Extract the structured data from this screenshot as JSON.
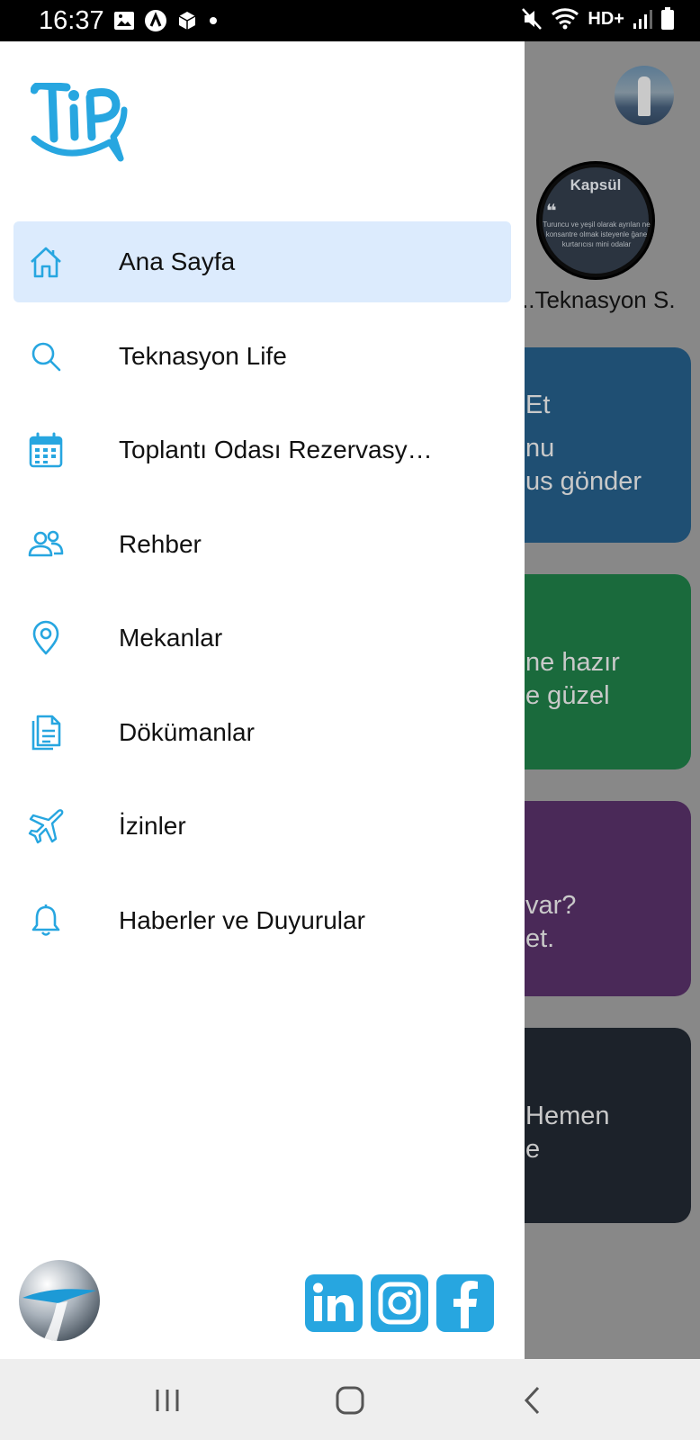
{
  "status_bar": {
    "time": "16:37",
    "network_label": "HD+",
    "icons_left": [
      "image-icon",
      "a-circle-icon",
      "package-icon",
      "dot-icon"
    ],
    "icons_right": [
      "mute-icon",
      "wifi-icon",
      "signal-icon",
      "battery-icon"
    ]
  },
  "background": {
    "story": {
      "title": "Kapsül",
      "quote_mark": "❝",
      "text": "Turuncu ve yeşil olarak ayrılan ne konsantre olmak isteyenle ğane kurtarıcısı mini odalar",
      "label": "..Teknasyon S."
    },
    "cards": [
      {
        "lines": [
          "Et",
          "nu",
          "us gönder"
        ]
      },
      {
        "lines": [
          "ne hazır",
          "e güzel"
        ]
      },
      {
        "lines": [
          "var?",
          "et."
        ]
      },
      {
        "lines": [
          "Hemen",
          "e"
        ]
      }
    ]
  },
  "drawer": {
    "logo_text": "TiP",
    "menu": [
      {
        "label": "Ana Sayfa",
        "icon": "home-icon",
        "active": true
      },
      {
        "label": "Teknasyon Life",
        "icon": "search-icon",
        "active": false
      },
      {
        "label": "Toplantı Odası Rezervasy…",
        "icon": "calendar-icon",
        "active": false
      },
      {
        "label": "Rehber",
        "icon": "users-icon",
        "active": false
      },
      {
        "label": "Mekanlar",
        "icon": "location-pin-icon",
        "active": false
      },
      {
        "label": "Dökümanlar",
        "icon": "documents-icon",
        "active": false
      },
      {
        "label": "İzinler",
        "icon": "airplane-icon",
        "active": false
      },
      {
        "label": "Haberler ve Duyurular",
        "icon": "bell-icon",
        "active": false
      }
    ],
    "socials": [
      "linkedin-icon",
      "instagram-icon",
      "facebook-icon"
    ],
    "accent_color": "#27a6e0",
    "active_bg": "#dcebfd"
  },
  "nav_bar": {
    "buttons": [
      "recent-apps-icon",
      "home-button-icon",
      "back-icon"
    ]
  }
}
